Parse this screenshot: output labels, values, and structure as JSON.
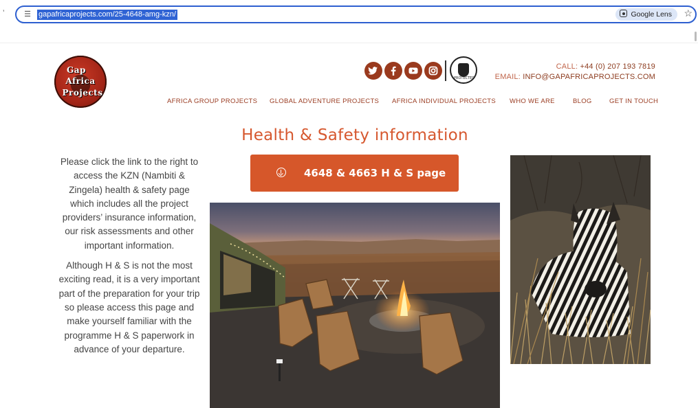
{
  "browser": {
    "url": "gapafricaprojects.com/25-4648-amg-kzn/",
    "lens_label": "Google Lens",
    "left_marker": "’"
  },
  "site": {
    "logo": {
      "line1": "Gap",
      "line2": "Africa",
      "line3": "Projects"
    },
    "social_icons": [
      "twitter-icon",
      "facebook-icon",
      "youtube-icon",
      "instagram-icon"
    ],
    "badge_text": "PROTECTED",
    "contact": {
      "call_label": "CALL:",
      "call_value": "+44 (0) 207 193 7819",
      "email_label": "EMAIL:",
      "email_value": "INFO@GAPAFRICAPROJECTS.COM"
    },
    "nav": [
      "AFRICA GROUP PROJECTS",
      "GLOBAL ADVENTURE PROJECTS",
      "AFRICA INDIVIDUAL PROJECTS",
      "WHO WE ARE",
      "BLOG",
      "GET IN TOUCH"
    ]
  },
  "main": {
    "heading": "Health & Safety information",
    "cta_label": "4648 & 4663 H & S page",
    "paragraph1": "Please click the link to the right to access the KZN (Nambiti & Zingela) health & safety page which includes all the project providers’ insurance information, our risk assessments and other important information.",
    "paragraph2": "Although H & S is not the most exciting read, it is a very important part of the preparation for your trip so please access this page and make yourself familiar with the programme H & S paperwork in advance of your departure."
  },
  "colors": {
    "accent": "#d6572a",
    "nav": "#9a3c22",
    "browser_focus": "#2d5fd0"
  }
}
